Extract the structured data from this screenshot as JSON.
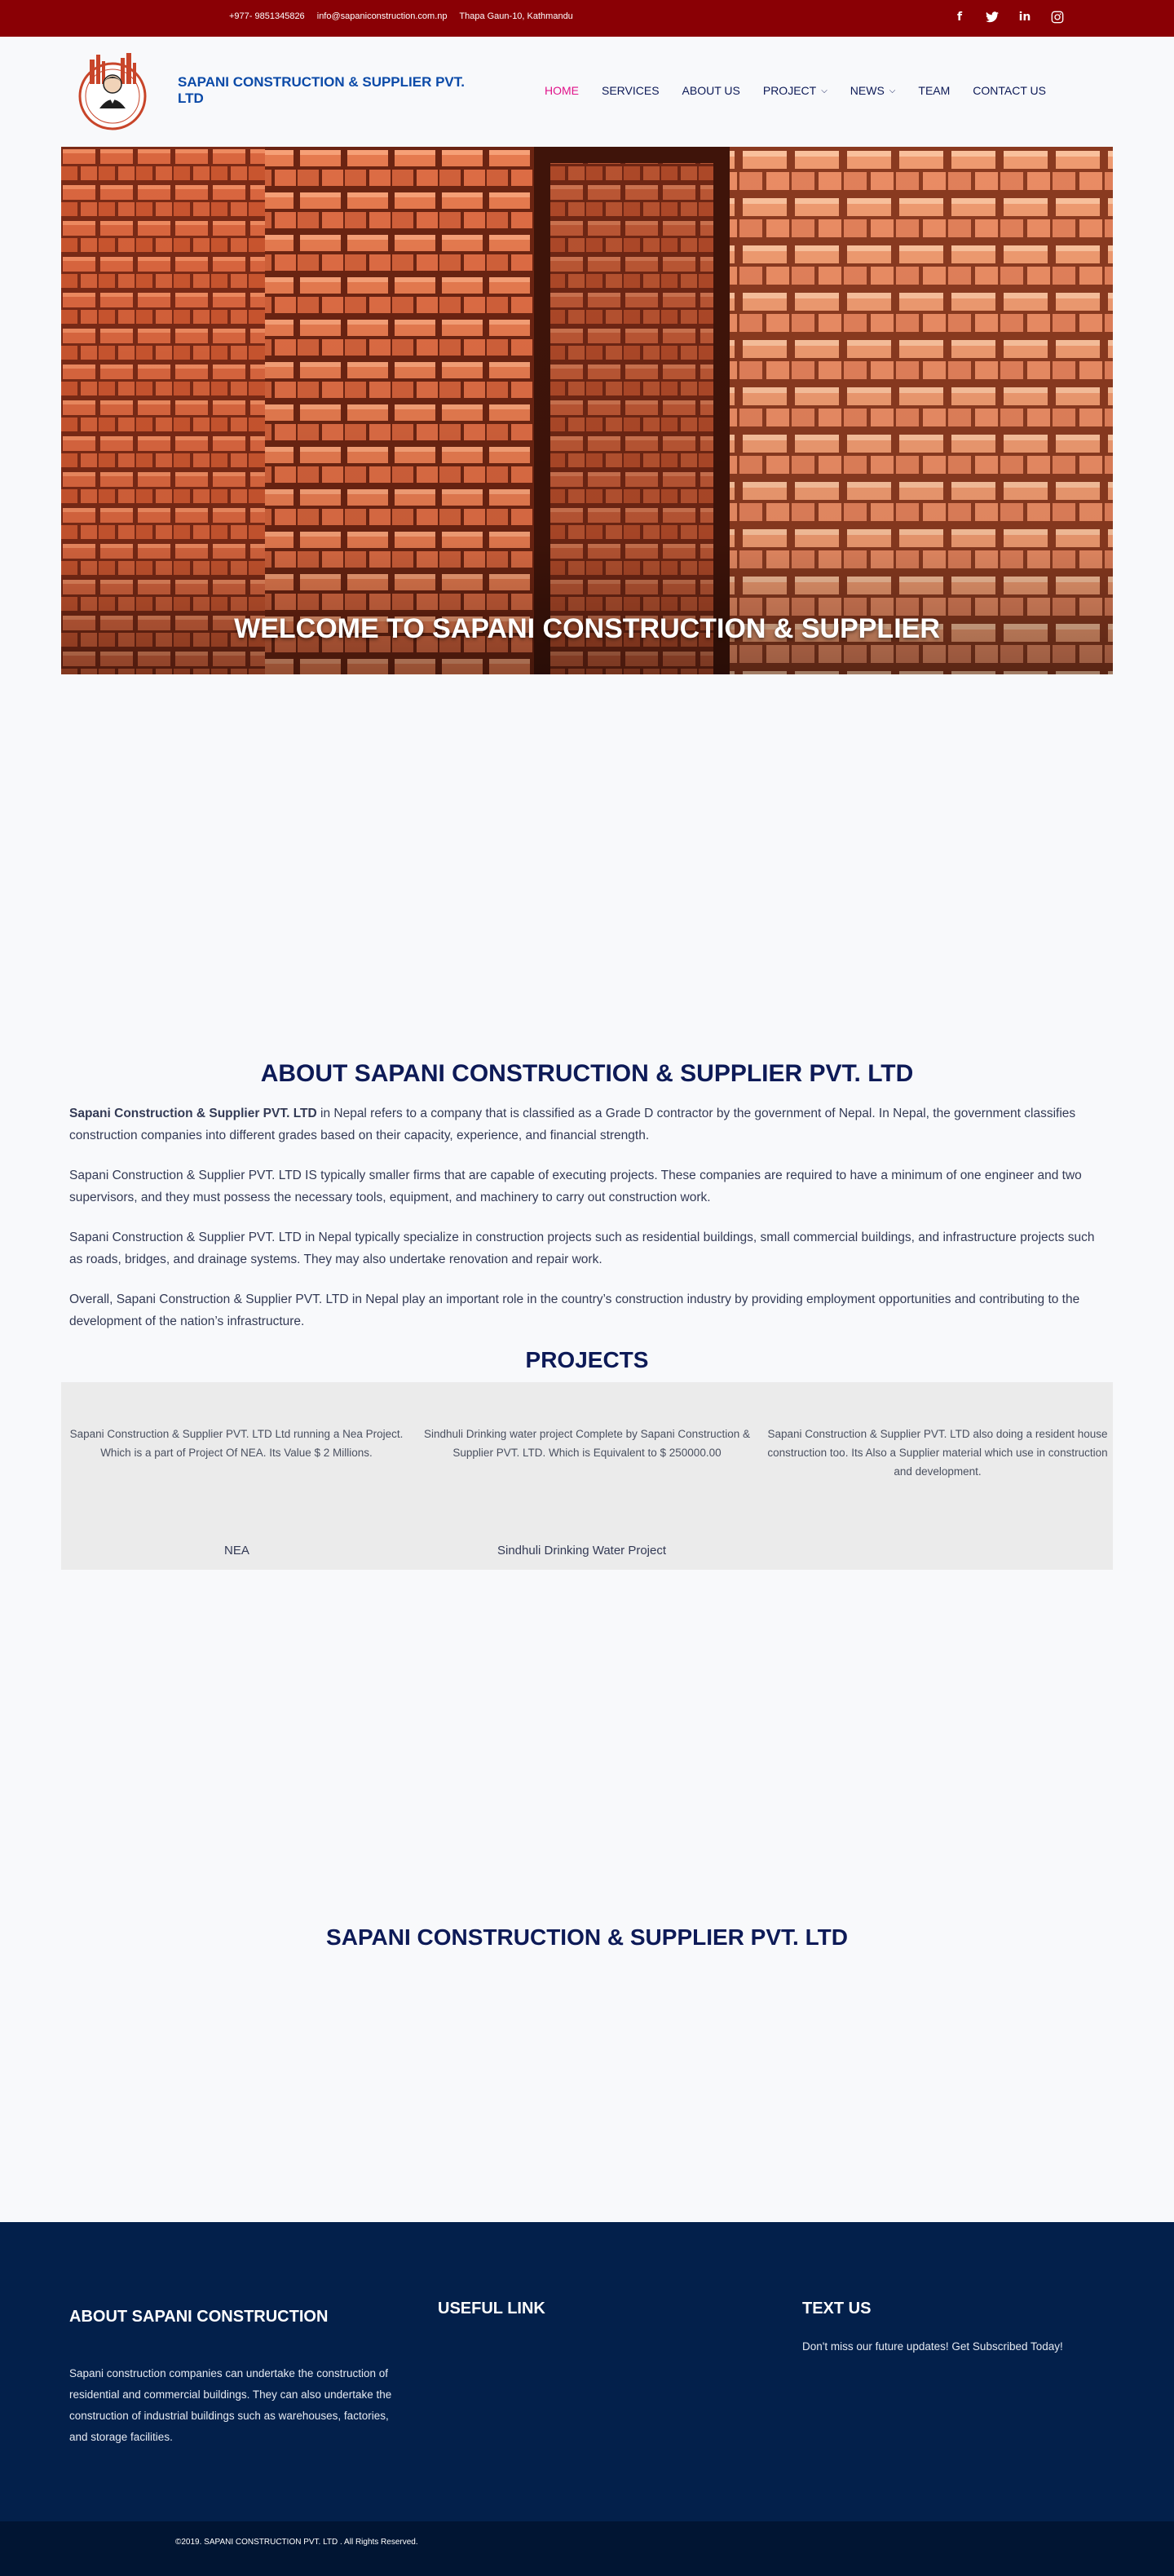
{
  "topbar": {
    "phone": "+977- 9851345826",
    "email": "info@sapaniconstruction.com.np",
    "address": "Thapa Gaun-10, Kathmandu",
    "social": [
      {
        "icon": "facebook-icon",
        "glyph": "f"
      },
      {
        "icon": "twitter-icon",
        "glyph": "t"
      },
      {
        "icon": "linkedin-icon",
        "glyph": "in"
      },
      {
        "icon": "instagram-icon",
        "glyph": "◎"
      }
    ]
  },
  "header": {
    "brand": "SAPANI CONSTRUCTION & SUPPLIER PVT. LTD",
    "nav": [
      {
        "label": "HOME",
        "active": true,
        "dropdown": false
      },
      {
        "label": "SERVICES",
        "active": false,
        "dropdown": false
      },
      {
        "label": "ABOUT US",
        "active": false,
        "dropdown": false
      },
      {
        "label": "PROJECT",
        "active": false,
        "dropdown": true
      },
      {
        "label": "NEWS",
        "active": false,
        "dropdown": true
      },
      {
        "label": "TEAM",
        "active": false,
        "dropdown": false
      },
      {
        "label": "CONTACT US",
        "active": false,
        "dropdown": false
      }
    ]
  },
  "hero": {
    "title": "WELCOME TO SAPANI CONSTRUCTION & SUPPLIER"
  },
  "about": {
    "title": "ABOUT SAPANI CONSTRUCTION & SUPPLIER PVT. LTD",
    "lead_bold": "Sapani Construction & Supplier PVT. LTD",
    "p1_rest": " in Nepal refers to a company that is classified as a Grade D contractor by the government of Nepal. In Nepal, the government classifies construction companies into different grades based on their capacity, experience, and financial strength.",
    "p2": "Sapani Construction & Supplier PVT. LTD IS typically smaller firms that are capable of executing projects. These companies are required to have a minimum of one engineer and two supervisors, and they must possess the necessary tools, equipment, and machinery to carry out construction work.",
    "p3": "Sapani Construction & Supplier PVT. LTD in Nepal typically specialize in construction projects such as residential buildings, small commercial buildings, and infrastructure projects such as roads, bridges, and drainage systems. They may also undertake renovation and repair work.",
    "p4": "Overall, Sapani Construction & Supplier PVT. LTD in Nepal play an important role in the country’s construction industry by providing employment opportunities and contributing to the development of the nation’s infrastructure."
  },
  "projects": {
    "title": "PROJECTS",
    "items": [
      {
        "description": "Sapani Construction & Supplier PVT. LTD Ltd running a Nea Project. Which is a part of Project Of NEA. Its Value $ 2 Millions.",
        "name": "NEA"
      },
      {
        "description": "Sindhuli Drinking water project Complete by Sapani Construction & Supplier PVT. LTD. Which is Equivalent to $ 250000.00",
        "name": "Sindhuli Drinking Water Project"
      },
      {
        "description": "Sapani Construction & Supplier PVT. LTD also doing a resident house construction too. Its Also a Supplier material which use in construction and development.",
        "name": ""
      }
    ]
  },
  "company": {
    "title": "SAPANI CONSTRUCTION & SUPPLIER PVT. LTD"
  },
  "footer": {
    "about_title": "ABOUT SAPANI CONSTRUCTION",
    "about_text": "Sapani construction companies can undertake the construction of residential and commercial buildings. They can also undertake the construction of industrial buildings such as warehouses, factories, and storage facilities.",
    "links_title": "USEFUL LINK",
    "text_title": "TEXT US",
    "text_body": "Don't miss our future updates! Get Subscribed Today!",
    "copyright": "©2019. SAPANI CONSTRUCTION PVT. LTD . All Rights Reserved."
  },
  "colors": {
    "topbar": "#8a0005",
    "brand": "#0b4aa8",
    "nav_active": "#e0148a",
    "heading": "#0d1a57",
    "footer": "#03204b"
  }
}
